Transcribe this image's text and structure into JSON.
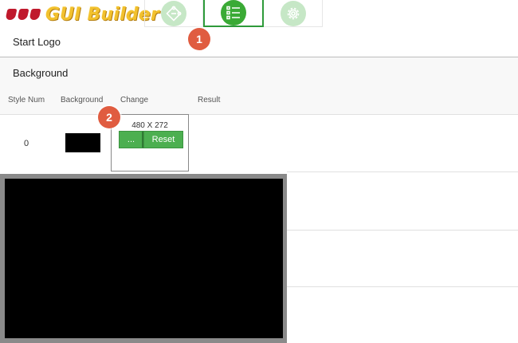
{
  "app": {
    "title": "GUI Builder"
  },
  "tabs": [
    {
      "icon": "puzzle-icon",
      "active": false
    },
    {
      "icon": "list-icon",
      "active": true
    },
    {
      "icon": "gear-icon",
      "active": false
    }
  ],
  "sections": {
    "start_logo": "Start Logo",
    "background": "Background"
  },
  "table": {
    "headers": [
      "Style Num",
      "Background",
      "Change",
      "Result"
    ],
    "rows": [
      {
        "style_num": "0",
        "background_color": "#000000",
        "resolution": "480 X 272",
        "browse_label": "...",
        "reset_label": "Reset"
      }
    ]
  },
  "callouts": [
    "1",
    "2"
  ],
  "colors": {
    "accent": "#3aaa35",
    "callout": "#e05c40",
    "logo_red": "#c0192c",
    "logo_gold": "#f2c12e"
  }
}
